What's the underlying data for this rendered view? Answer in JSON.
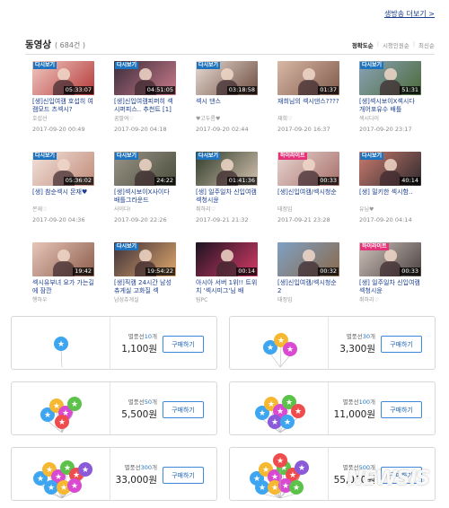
{
  "top_link": "생방송 더보기 >",
  "section": {
    "title": "동영상",
    "count": "( 684건 )"
  },
  "sort": {
    "options": [
      "정확도순",
      "시청인원순",
      "최신순"
    ],
    "active": 0
  },
  "videos": [
    {
      "badge": "다시보기",
      "badge_type": "replay",
      "duration": "05:33:07",
      "title": "[생]신입여캠 호섭히 여캠모드 츠섹시?",
      "author": "호섭선",
      "date": "2017-09-20 00:49",
      "colors": [
        "#f1c9c2",
        "#b43a3a"
      ]
    },
    {
      "badge": "다시보기",
      "badge_type": "replay",
      "duration": "04:51:05",
      "title": "[생]신입여캠피퍼히 섹시퍼피스.. 추천트 [1]",
      "author": "꿈팔여♡",
      "date": "2017-09-20 04:18",
      "colors": [
        "#3a2c3a",
        "#c97a8a"
      ]
    },
    {
      "badge": "다시보기",
      "badge_type": "replay",
      "duration": "03:18:58",
      "title": "섹시 댄스",
      "author": "♥고두름♥",
      "date": "2017-09-20 02:44",
      "colors": [
        "#e8ddd6",
        "#6e4b3e"
      ]
    },
    {
      "badge": "",
      "badge_type": "none",
      "duration": "01:37",
      "title": "재희님의 섹시댄스????",
      "author": "재희♡",
      "date": "2017-09-20 16:37",
      "colors": [
        "#d9b8a6",
        "#7f5a4a"
      ]
    },
    {
      "badge": "다시보기",
      "badge_type": "replay",
      "duration": "51:31",
      "title": "[생]섹시보이X섹시다 개어포유수 배틀",
      "author": "섹시다이",
      "date": "2017-09-20 23:17",
      "colors": [
        "#8aa3b8",
        "#4d6b3a"
      ]
    },
    {
      "badge": "다시보기",
      "badge_type": "replay",
      "duration": "05:36:02",
      "title": "[생] 참순섹시 몬재♥",
      "author": "몬재♡",
      "date": "2017-09-20 04:36",
      "colors": [
        "#f3e3dc",
        "#c08a78"
      ]
    },
    {
      "badge": "다시보기",
      "badge_type": "replay",
      "duration": "24:22",
      "title": "[생]섹시보이X사이다 배틀그라운드",
      "author": "사이다!",
      "date": "2017-09-20 22:26",
      "colors": [
        "#9a9488",
        "#4a4d3c"
      ]
    },
    {
      "badge": "다시보기",
      "badge_type": "replay",
      "duration": "01:41:36",
      "title": "[생] 일주일차 신입여캠 섹청시윤",
      "author": "취하리♡",
      "date": "2017-09-21 21:32",
      "colors": [
        "#2e3b2a",
        "#d6c3b0"
      ]
    },
    {
      "badge": "하이라이트",
      "badge_type": "highlight",
      "duration": "00:33",
      "title": "[생]신입여캠/섹시청순",
      "author": "태정임",
      "date": "2017-09-21 23:28",
      "colors": [
        "#e8d6d2",
        "#a76f6a"
      ]
    },
    {
      "badge": "다시보기",
      "badge_type": "replay",
      "duration": "40:14",
      "title": "[생] 밀키한 섹시함..",
      "author": "유님♥",
      "date": "2017-09-20 04:14",
      "colors": [
        "#c97b6e",
        "#2f2a2e"
      ]
    },
    {
      "badge": "",
      "badge_type": "none",
      "duration": "19:42",
      "title": "섹시유부녀 요가 가는길에 잠깐",
      "author": "행하우",
      "date": "",
      "colors": [
        "#e6c6b8",
        "#8c5c4c"
      ]
    },
    {
      "badge": "다시보기",
      "badge_type": "replay",
      "duration": "19:54:22",
      "title": "[생]직캠 24시간 남성츄게실 고화질 섹",
      "author": "남성츄게실",
      "date": "",
      "colors": [
        "#3b2f3a",
        "#e0a86a"
      ]
    },
    {
      "badge": "",
      "badge_type": "none",
      "duration": "00:14",
      "title": "아시아 서버 1위!! 트위치 '섹시미그'님 배",
      "author": "팀PC",
      "date": "",
      "colors": [
        "#1c1420",
        "#d63a68"
      ]
    },
    {
      "badge": "",
      "badge_type": "none",
      "duration": "00:32",
      "title": "[생]신입여캠/섹시청순2",
      "author": "태정임",
      "date": "",
      "colors": [
        "#7fa0c4",
        "#8a6a4a"
      ]
    },
    {
      "badge": "하이라이트",
      "badge_type": "highlight",
      "duration": "00:33",
      "title": "[생] 일주일차 신입여캠 섹청시윤",
      "author": "취하리♡",
      "date": "",
      "colors": [
        "#cfc3bb",
        "#4a4140"
      ]
    }
  ],
  "products": [
    {
      "label": "별풍선",
      "count": "10",
      "unit": "개",
      "price": "1,100원",
      "button": "구매하기",
      "balloons": 1
    },
    {
      "label": "별풍선",
      "count": "30",
      "unit": "개",
      "price": "3,300원",
      "button": "구매하기",
      "balloons": 3
    },
    {
      "label": "별풍선",
      "count": "50",
      "unit": "개",
      "price": "5,500원",
      "button": "구매하기",
      "balloons": 5
    },
    {
      "label": "별풍선",
      "count": "100",
      "unit": "개",
      "price": "11,000원",
      "button": "구매하기",
      "balloons": 7
    },
    {
      "label": "별풍선",
      "count": "300",
      "unit": "개",
      "price": "33,000원",
      "button": "구매하기",
      "balloons": 9
    },
    {
      "label": "별풍선",
      "count": "500",
      "unit": "개",
      "price": "55,000원",
      "button": "구매하기",
      "balloons": 11
    }
  ],
  "balloon_colors": [
    "#3ea6f0",
    "#f5b830",
    "#d94ad0",
    "#5cc24a",
    "#ef4d4d",
    "#8a5ad8"
  ],
  "watermark": "NEWSIS"
}
